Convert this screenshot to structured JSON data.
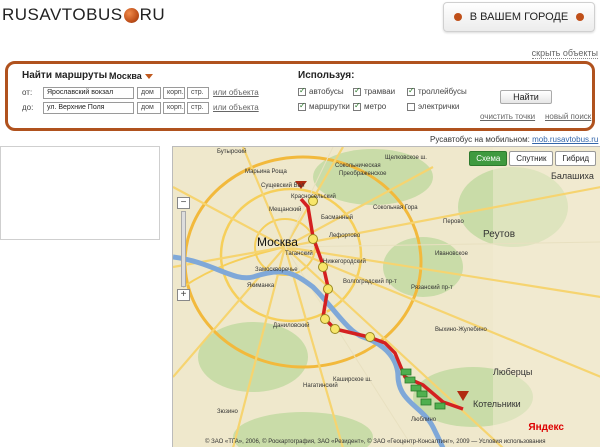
{
  "header": {
    "logo_left": "RUSAVTOBUS",
    "logo_right": "RU",
    "city_button": "В ВАШЕМ ГОРОДЕ",
    "hide_objects": "скрыть объекты"
  },
  "search": {
    "title": "Найти маршруты",
    "city": "Москва",
    "from_label": "от:",
    "to_label": "до:",
    "from_value": "Ярославский вокзал",
    "to_value": "ул. Верхние Поля",
    "house_placeholder": "дом",
    "building_placeholder": "корп.",
    "structure_placeholder": "стр.",
    "or_object": "или объекта",
    "uses_title": "Используя:",
    "transport": [
      {
        "label": "автобусы",
        "checked": true
      },
      {
        "label": "трамваи",
        "checked": true
      },
      {
        "label": "троллейбусы",
        "checked": true
      },
      {
        "label": "маршрутки",
        "checked": true
      },
      {
        "label": "метро",
        "checked": true
      },
      {
        "label": "электрички",
        "checked": false
      }
    ],
    "find_button": "Найти",
    "clear_points": "очистить точки",
    "new_search": "новый поиск"
  },
  "mobile": {
    "text": "Русавтобус на мобильном:",
    "link": "mob.rusavtobus.ru"
  },
  "map": {
    "types": [
      "Схема",
      "Спутник",
      "Гибрид"
    ],
    "active_type": "Схема",
    "city_label": "Москва",
    "labels": [
      "Бутырский",
      "Сущевский Вал",
      "Красносельский",
      "Мещанский",
      "Басманный",
      "Сокольническая",
      "Преображенское",
      "Сокольная Гора",
      "Перово",
      "Реутов",
      "Балашиха",
      "Таганский",
      "Замоскворечье",
      "Нижегородский",
      "Лефортово",
      "Ивановское",
      "Якиманка",
      "Даниловский",
      "Выхино-Жулебино",
      "Люберцы",
      "Люблино",
      "Котельники",
      "Нагатинский",
      "Зюзино",
      "Марьина Роща",
      "Щелковское ш.",
      "Рязанский пр-т",
      "Волгоградский пр-т",
      "Каширское ш."
    ],
    "copyright": "© ЗАО «ТГА», 2006, © Роскартография, ЗАО «Резидент», © ЗАО «Геоцентр-Консалтинг», 2009 — Условия использования",
    "logo": "Яндекс"
  },
  "colors": {
    "accent": "#b0521e",
    "route": "#d42020",
    "active_map_type": "#3f9a3f"
  }
}
